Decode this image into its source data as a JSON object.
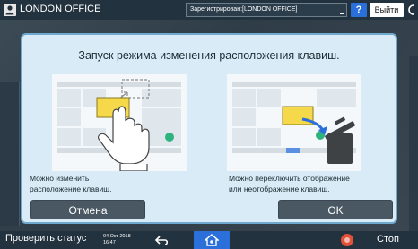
{
  "topbar": {
    "user_label": "LONDON OFFICE",
    "login_status": "Зарегистрирован:[LONDON OFFICE]",
    "help_label": "?",
    "logout_label": "Выйти"
  },
  "dialog": {
    "title": "Запуск режима изменения расположения клавиш.",
    "left_caption_line1": "Можно изменить",
    "left_caption_line2": "расположение клавиш.",
    "right_caption_line1": "Можно переключить отображение",
    "right_caption_line2": "или неотображение клавиш.",
    "cancel_label": "Отмена",
    "ok_label": "OK"
  },
  "bottombar": {
    "status_label": "Проверить статус",
    "date": "04 Окт 2018",
    "time": "16:47",
    "stop_label": "Стоп"
  },
  "colors": {
    "dialog_bg": "#d8ebf6",
    "accent_blue": "#2b6fdb",
    "highlight_yellow": "#f6d94a",
    "stop_red": "#e2503a"
  }
}
